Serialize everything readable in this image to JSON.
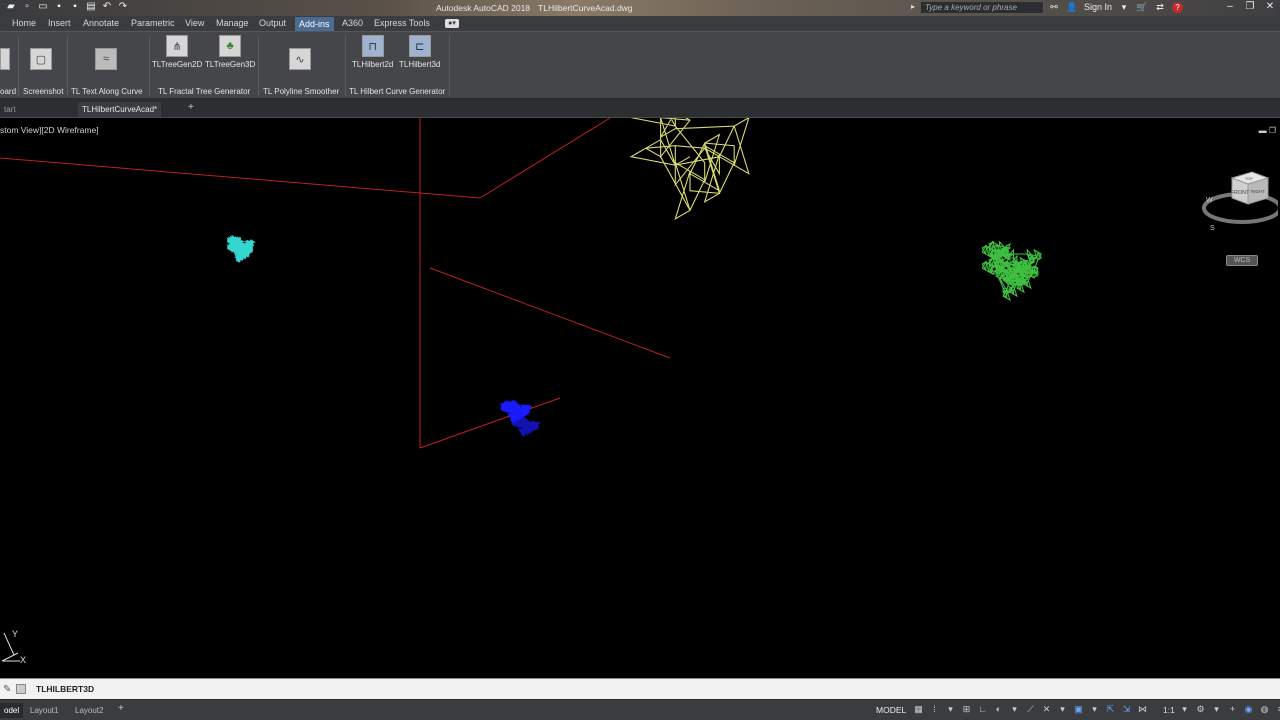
{
  "title_bar": {
    "app_name": "Autodesk AutoCAD 2018",
    "file_name": "TLHilbertCurveAcad.dwg",
    "search_placeholder": "Type a keyword or phrase",
    "sign_in": "Sign In"
  },
  "ribbon_tabs": [
    "Home",
    "Insert",
    "Annotate",
    "Parametric",
    "View",
    "Manage",
    "Output",
    "Add-ins",
    "A360",
    "Express Tools"
  ],
  "active_ribbon_tab": "Add-ins",
  "ribbon": {
    "buttons": {
      "treegen2d": "TLTreeGen2D",
      "treegen3d": "TLTreeGen3D",
      "hilbert2d": "TLHilbert2d",
      "hilbert3d": "TLHilbert3d"
    },
    "panels": {
      "board": "oard",
      "screenshot": "Screenshot",
      "text_along_curve": "TL Text Along Curve",
      "fractal_tree": "TL Fractal Tree Generator",
      "polyline_smoother": "TL Polyline Smoother",
      "hilbert_curve": "TL Hilbert Curve Generator"
    }
  },
  "doc_tabs": {
    "start": "tart",
    "drawing": "TLHilbertCurveAcad*"
  },
  "viewport": {
    "view_label": "stom View][2D Wireframe]",
    "viewcube": {
      "top": "TOP",
      "front": "FRONT",
      "right": "RIGHT",
      "compass_w": "W",
      "compass_s": "S"
    },
    "wcs": "WCS",
    "ucs_x": "X",
    "ucs_y": "Y"
  },
  "command_line": {
    "text": "TLHILBERT3D"
  },
  "status_bar": {
    "layout_tabs": [
      "odel",
      "Layout1",
      "Layout2"
    ],
    "model_label": "MODEL",
    "scale": "1:1"
  },
  "colors": {
    "cyan_curve": "#35d6d0",
    "blue_curve": "#1a1aff",
    "yellow_curve": "#d8d870",
    "green_curve": "#3fbf3f",
    "red_axis": "#c02020",
    "ribbon_active": "#4a6b93"
  }
}
